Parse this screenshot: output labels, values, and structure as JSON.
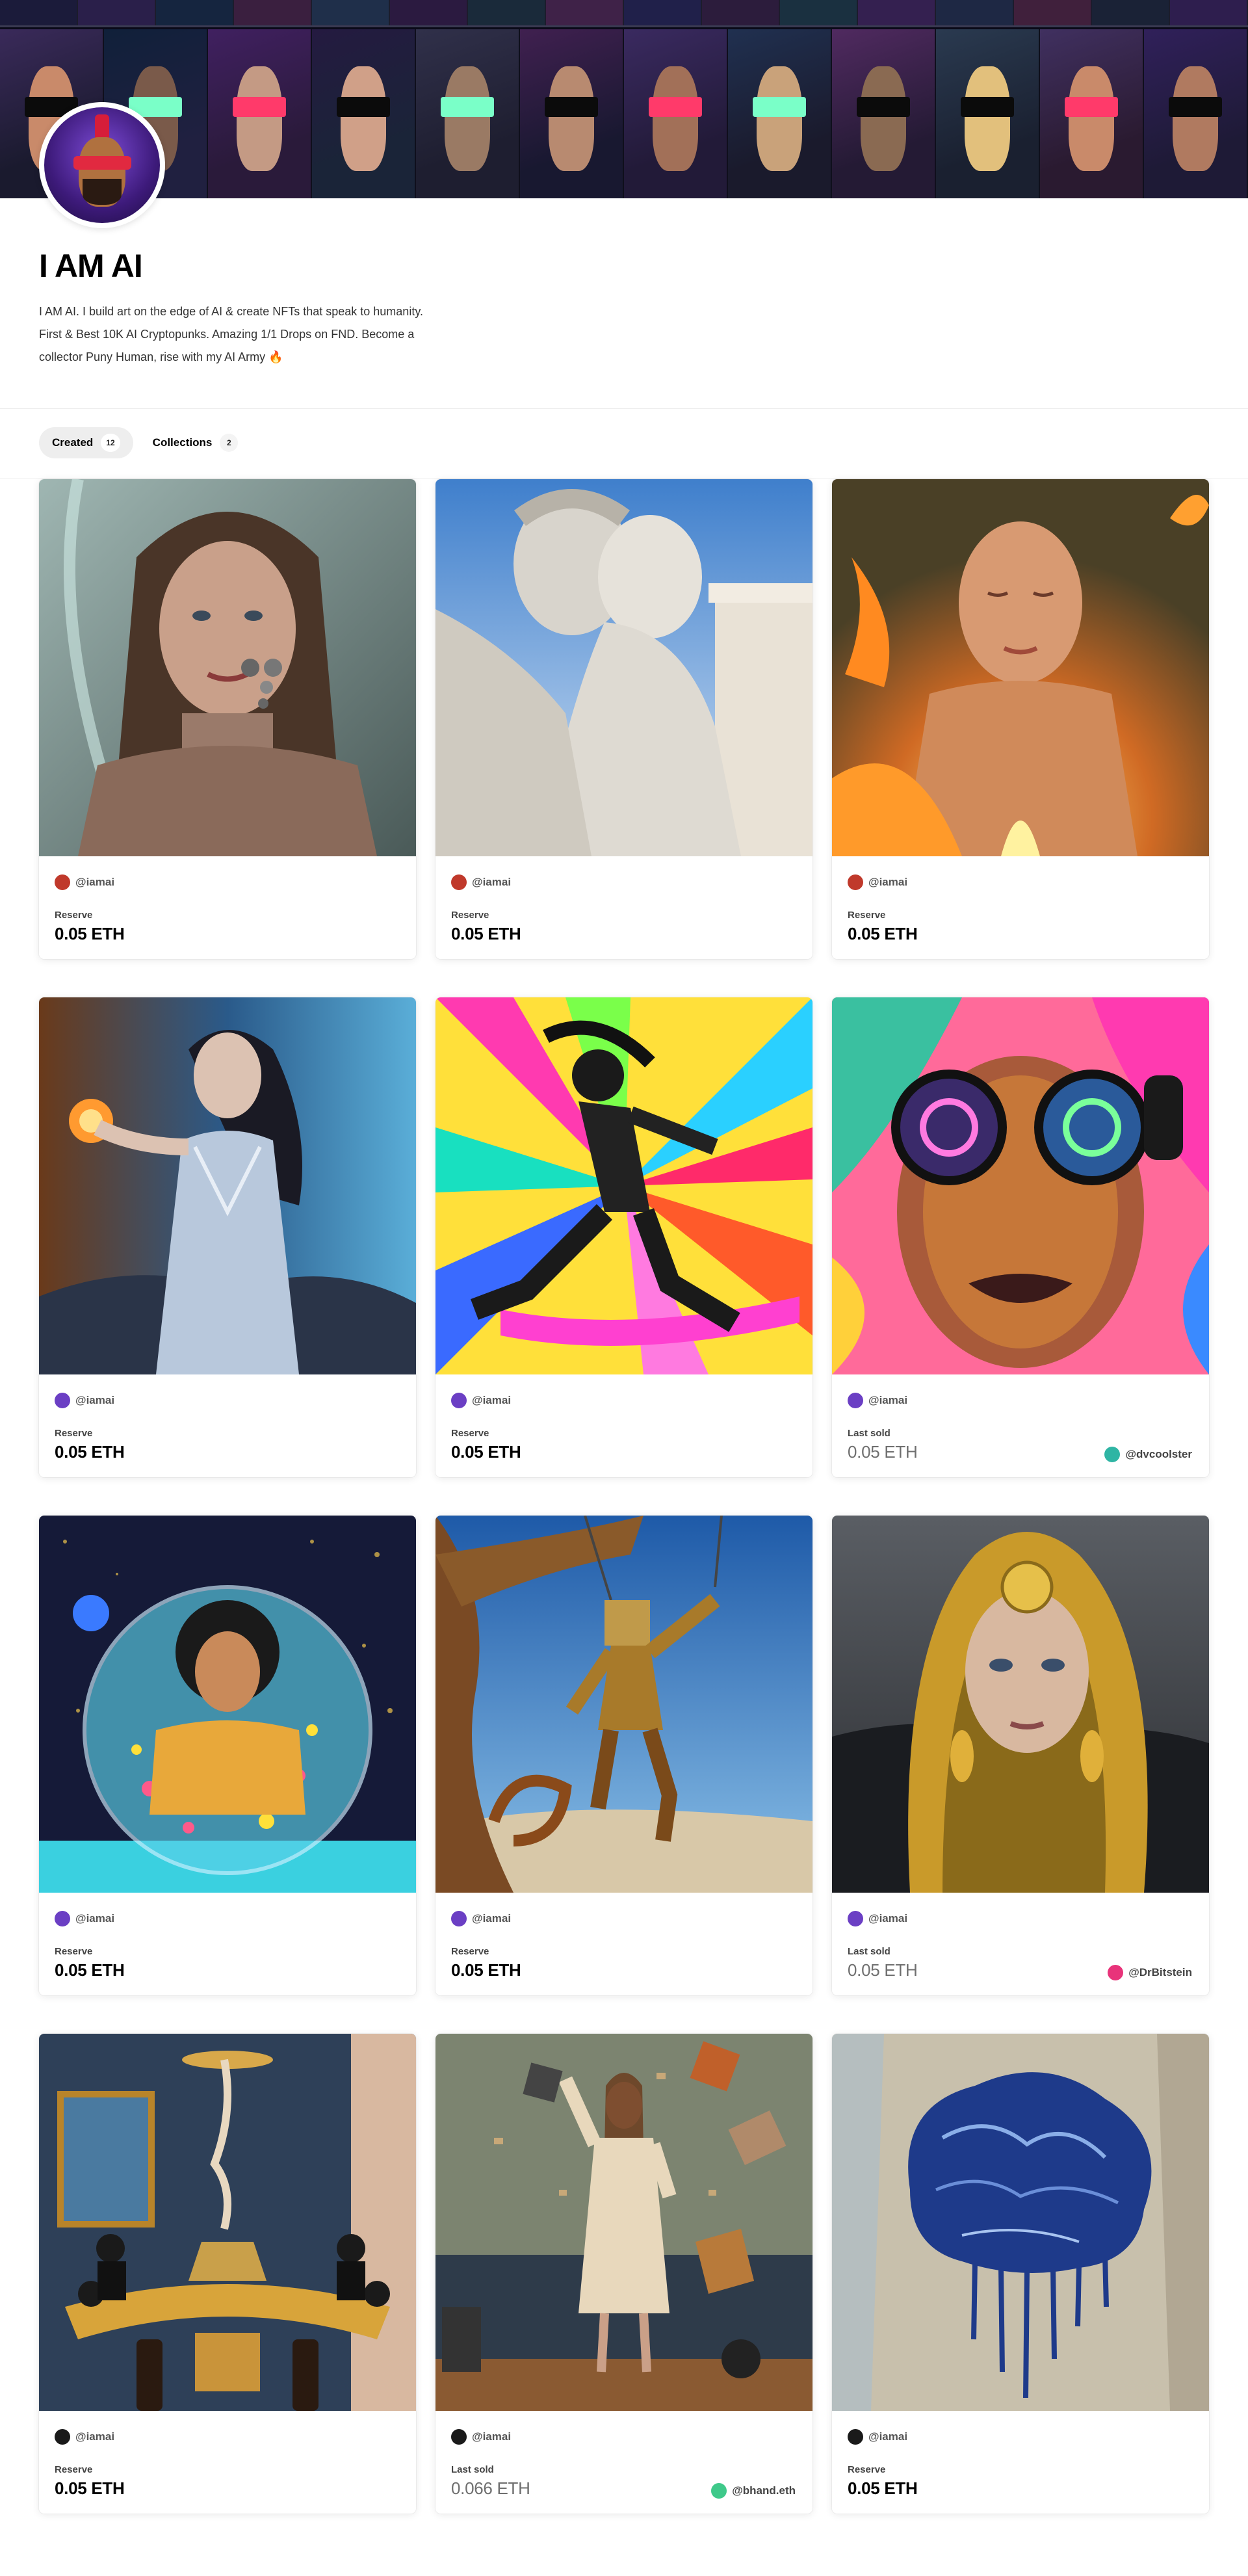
{
  "profile": {
    "name": "I AM AI",
    "bio": "I AM AI. I build art on the edge of AI & create NFTs that speak to humanity. First & Best 10K AI Cryptopunks. Amazing 1/1 Drops on FND. Become a collector Puny Human, rise with my AI Army 🔥"
  },
  "tabs": [
    {
      "label": "Created",
      "count": "12",
      "active": true
    },
    {
      "label": "Collections",
      "count": "2",
      "active": false
    }
  ],
  "cards": [
    {
      "artwork": "woman-porcelain-portrait",
      "creator": "@iamai",
      "status_label": "Reserve",
      "price": "0.05 ETH",
      "owner": ""
    },
    {
      "artwork": "marble-statues-embrace",
      "creator": "@iamai",
      "status_label": "Reserve",
      "price": "0.05 ETH",
      "owner": ""
    },
    {
      "artwork": "woman-flames",
      "creator": "@iamai",
      "status_label": "Reserve",
      "price": "0.05 ETH",
      "owner": ""
    },
    {
      "artwork": "woman-silver-dress-fire",
      "creator": "@iamai",
      "status_label": "Reserve",
      "price": "0.05 ETH",
      "owner": ""
    },
    {
      "artwork": "dancer-color-burst",
      "creator": "@iamai",
      "status_label": "Reserve",
      "price": "0.05 ETH",
      "owner": ""
    },
    {
      "artwork": "psychedelic-glasses-face",
      "creator": "@iamai",
      "status_label": "Last sold",
      "price": "0.05 ETH",
      "owner": "@dvcoolster"
    },
    {
      "artwork": "woman-in-bubble",
      "creator": "@iamai",
      "status_label": "Reserve",
      "price": "0.05 ETH",
      "owner": ""
    },
    {
      "artwork": "hanging-puppet",
      "creator": "@iamai",
      "status_label": "Reserve",
      "price": "0.05 ETH",
      "owner": ""
    },
    {
      "artwork": "golden-hood-woman",
      "creator": "@iamai",
      "status_label": "Last sold",
      "price": "0.05 ETH",
      "owner": "@DrBitstein"
    },
    {
      "artwork": "boardroom-table",
      "creator": "@iamai",
      "status_label": "Reserve",
      "price": "0.05 ETH",
      "owner": ""
    },
    {
      "artwork": "woman-flying-objects",
      "creator": "@iamai",
      "status_label": "Last sold",
      "price": "0.066 ETH",
      "owner": "@bhand.eth"
    },
    {
      "artwork": "blue-brain-painting",
      "creator": "@iamai",
      "status_label": "Reserve",
      "price": "0.05 ETH",
      "owner": ""
    }
  ],
  "colors": {
    "owner_dvcoolster": "#2fb5a4",
    "owner_drbitstein": "#e8337a",
    "owner_bhand": "#3fc98a",
    "avatar_purple": "#6b3fc4"
  }
}
